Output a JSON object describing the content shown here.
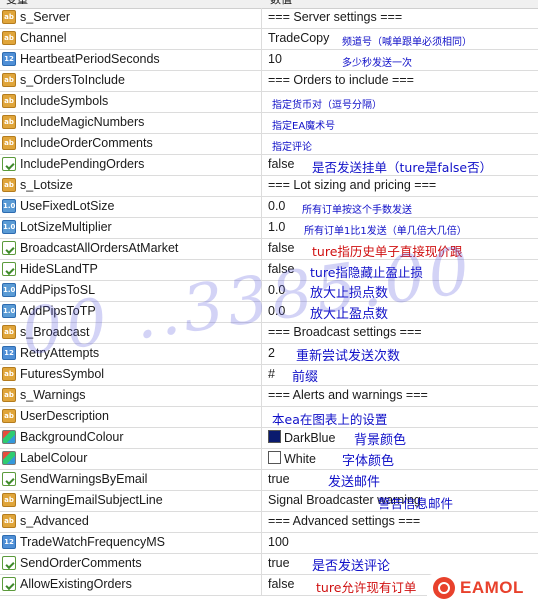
{
  "header": {
    "col_name": "变量",
    "col_value": "数值"
  },
  "rows": [
    {
      "name": "s_Server",
      "icon": "ab",
      "value": "=== Server settings ===",
      "note": ""
    },
    {
      "name": "Channel",
      "icon": "ab",
      "value": "TradeCopy",
      "note": "频道号（喊单跟单必须相同）"
    },
    {
      "name": "HeartbeatPeriodSeconds",
      "icon": "num",
      "value": "10",
      "note": "多少秒发送一次"
    },
    {
      "name": "s_OrdersToInclude",
      "icon": "ab",
      "value": "=== Orders to include ===",
      "note": ""
    },
    {
      "name": "IncludeSymbols",
      "icon": "ab",
      "value": "",
      "note": "指定货币对（逗号分隔）"
    },
    {
      "name": "IncludeMagicNumbers",
      "icon": "ab",
      "value": "",
      "note": "指定EA魔术号"
    },
    {
      "name": "IncludeOrderComments",
      "icon": "ab",
      "value": "",
      "note": "指定评论"
    },
    {
      "name": "IncludePendingOrders",
      "icon": "bool",
      "value": "false",
      "note": "是否发送挂单（ture是false否）"
    },
    {
      "name": "s_Lotsize",
      "icon": "ab",
      "value": "=== Lot sizing and pricing ===",
      "note": ""
    },
    {
      "name": "UseFixedLotSize",
      "icon": "dec",
      "value": "0.0",
      "note": "所有订单按这个手数发送"
    },
    {
      "name": "LotSizeMultiplier",
      "icon": "dec",
      "value": "1.0",
      "note": "所有订单1比1发送（单几倍大几倍）"
    },
    {
      "name": "BroadcastAllOrdersAtMarket",
      "icon": "bool",
      "value": "false",
      "note": "ture指历史单子直接现价跟"
    },
    {
      "name": "HideSLandTP",
      "icon": "bool",
      "value": "false",
      "note": "ture指隐藏止盈止损"
    },
    {
      "name": "AddPipsToSL",
      "icon": "dec",
      "value": "0.0",
      "note": "放大止损点数"
    },
    {
      "name": "AddPipsToTP",
      "icon": "dec",
      "value": "0.0",
      "note": "放大止盈点数"
    },
    {
      "name": "s_Broadcast",
      "icon": "ab",
      "value": "=== Broadcast settings ===",
      "note": ""
    },
    {
      "name": "RetryAttempts",
      "icon": "num",
      "value": "2",
      "note": "重新尝试发送次数"
    },
    {
      "name": "FuturesSymbol",
      "icon": "ab",
      "value": "#",
      "note": "前缀"
    },
    {
      "name": "s_Warnings",
      "icon": "ab",
      "value": "=== Alerts and warnings ===",
      "note": ""
    },
    {
      "name": "UserDescription",
      "icon": "ab",
      "value": "",
      "note": "本ea在图表上的设置"
    },
    {
      "name": "BackgroundColour",
      "icon": "col",
      "value": "DarkBlue",
      "swatch": "#0a1a6e",
      "note": "背景颜色"
    },
    {
      "name": "LabelColour",
      "icon": "col",
      "value": "White",
      "swatch": "#ffffff",
      "note": "字体颜色"
    },
    {
      "name": "SendWarningsByEmail",
      "icon": "bool",
      "value": "true",
      "note": "发送邮件"
    },
    {
      "name": "WarningEmailSubjectLine",
      "icon": "ab",
      "value": "Signal Broadcaster warning",
      "note": "警告信息邮件"
    },
    {
      "name": "s_Advanced",
      "icon": "ab",
      "value": "=== Advanced settings ===",
      "note": ""
    },
    {
      "name": "TradeWatchFrequencyMS",
      "icon": "num",
      "value": "100",
      "note": ""
    },
    {
      "name": "SendOrderComments",
      "icon": "bool",
      "value": "true",
      "note": "是否发送评论"
    },
    {
      "name": "AllowExistingOrders",
      "icon": "bool",
      "value": "false",
      "note": "ture允许现有订单"
    }
  ],
  "watermark": "00 ..3385.00",
  "logo": {
    "text": "EAMOL"
  },
  "colors": {
    "note_blue": "#1010c8",
    "note_red": "#d01010",
    "logo_red": "#e8412c"
  }
}
